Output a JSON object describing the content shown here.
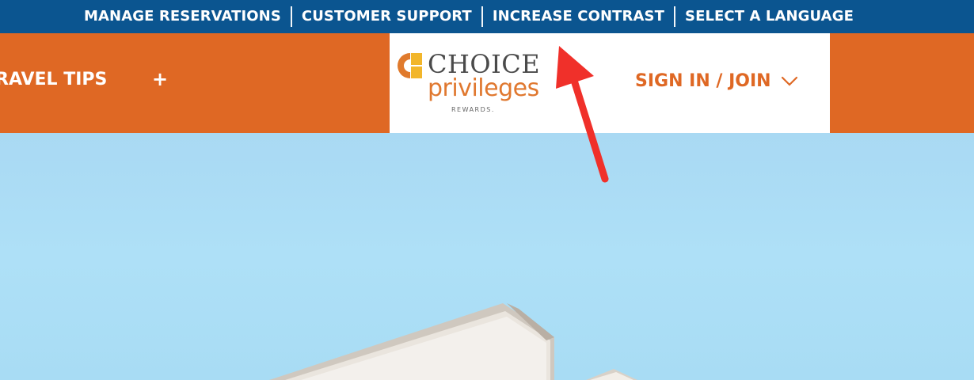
{
  "utility_bar": {
    "links": [
      "MANAGE RESERVATIONS",
      "CUSTOMER SUPPORT",
      "INCREASE CONTRAST",
      "SELECT A LANGUAGE"
    ]
  },
  "nav": {
    "item_label": "RAVEL TIPS",
    "expand_symbol": "+"
  },
  "brand": {
    "name_top": "CHOICE",
    "name_bottom": "privileges",
    "tagline": "REWARDS."
  },
  "account": {
    "signin_label": "SIGN IN / JOIN"
  },
  "colors": {
    "utility_bar": "#0b5590",
    "nav_bar": "#df6824",
    "accent_orange": "#df6824",
    "annotation_arrow": "#f0302a",
    "sky": "#a9d8f2"
  },
  "icons": {
    "signin_chevron": "chevron-down-icon",
    "logo_mark": "choice-logo-icon",
    "annotation": "red-arrow-icon"
  }
}
